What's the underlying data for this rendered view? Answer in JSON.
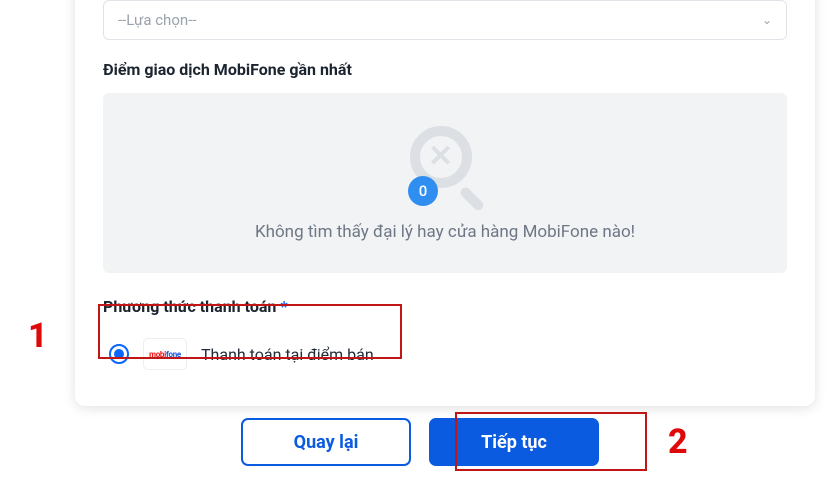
{
  "select": {
    "placeholder": "--Lựa chọn--"
  },
  "nearest_label": "Điểm giao dịch MobiFone gần nhất",
  "empty": {
    "count": "0",
    "message": "Không tìm thấy đại lý hay cửa hàng MobiFone nào!"
  },
  "payment": {
    "label": "Phương thức thanh toán",
    "required_mark": "*",
    "option": {
      "logo_text_front": "mobi",
      "logo_text_back": "fone",
      "label": "Thanh toán tại điểm bán",
      "selected": true
    }
  },
  "buttons": {
    "back": "Quay lại",
    "continue": "Tiếp tục"
  },
  "annotations": {
    "one": "1",
    "two": "2"
  }
}
